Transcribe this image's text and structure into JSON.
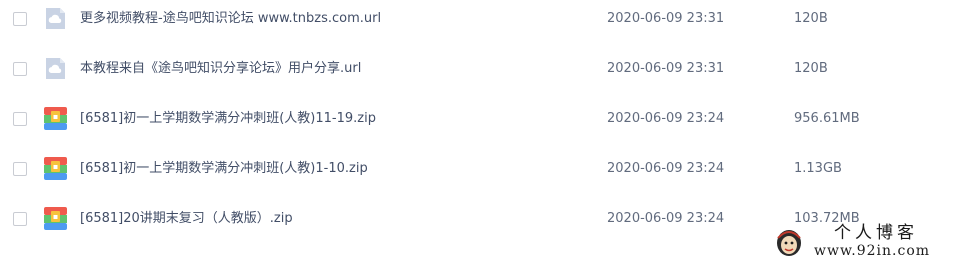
{
  "files": [
    {
      "name": "更多视频教程-途鸟吧知识论坛 www.tnbzs.com.url",
      "date": "2020-06-09 23:31",
      "size": "120B",
      "icon": "url-file-icon"
    },
    {
      "name": "本教程来自《途鸟吧知识分享论坛》用户分享.url",
      "date": "2020-06-09 23:31",
      "size": "120B",
      "icon": "url-file-icon"
    },
    {
      "name": "[6581]初一上学期数学满分冲刺班(人教)11-19.zip",
      "date": "2020-06-09 23:24",
      "size": "956.61MB",
      "icon": "zip-archive-icon"
    },
    {
      "name": "[6581]初一上学期数学满分冲刺班(人教)1-10.zip",
      "date": "2020-06-09 23:24",
      "size": "1.13GB",
      "icon": "zip-archive-icon"
    },
    {
      "name": "[6581]20讲期末复习（人教版）.zip",
      "date": "2020-06-09 23:24",
      "size": "103.72MB",
      "icon": "zip-archive-icon"
    }
  ],
  "watermark": {
    "title": "个人博客",
    "url": "www.92in.com"
  },
  "colors": {
    "text": "#424e67",
    "meta_text": "#616b7e",
    "checkbox_border": "#c9ccd3",
    "url_icon": "#c9d3e4",
    "zip_red": "#ef5a4d",
    "zip_green": "#5fc36e",
    "zip_blue": "#4d9bf0",
    "zip_yellow": "#f6c33d"
  }
}
